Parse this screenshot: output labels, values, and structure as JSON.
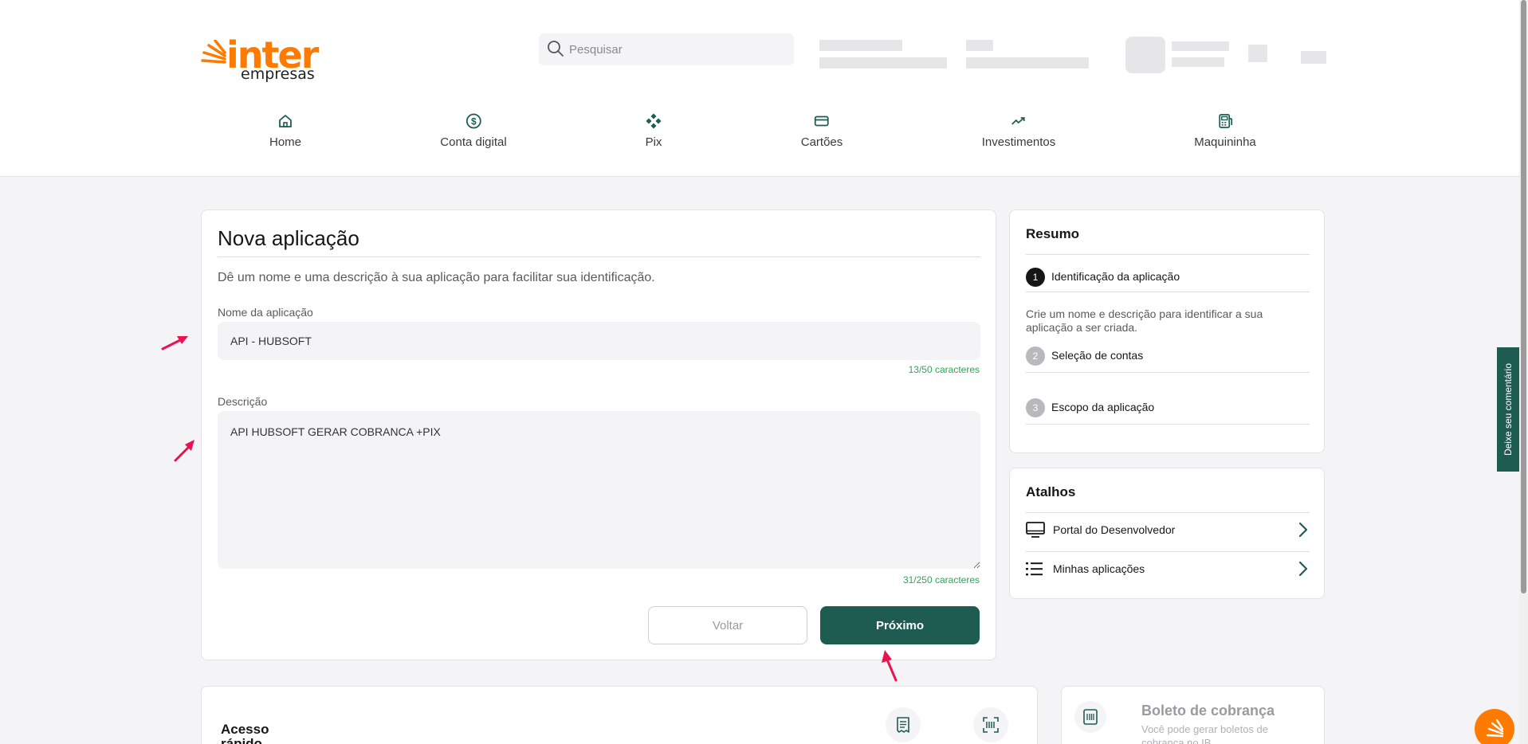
{
  "header": {
    "logo_brand": "inter",
    "logo_sub": "empresas",
    "search_placeholder": "Pesquisar"
  },
  "nav": [
    {
      "label": "Home",
      "icon": "home-icon"
    },
    {
      "label": "Conta digital",
      "icon": "dollar-circle-icon"
    },
    {
      "label": "Pix",
      "icon": "pix-icon"
    },
    {
      "label": "Cartões",
      "icon": "card-icon"
    },
    {
      "label": "Investimentos",
      "icon": "trend-up-icon"
    },
    {
      "label": "Maquininha",
      "icon": "pos-terminal-icon"
    }
  ],
  "form": {
    "title": "Nova aplicação",
    "intro": "Dê um nome e uma descrição à sua aplicação para facilitar sua identificação.",
    "name_label": "Nome da aplicação",
    "name_value": "API - HUBSOFT",
    "name_counter": "13/50 caracteres",
    "desc_label": "Descrição",
    "desc_value": "API HUBSOFT GERAR COBRANCA +PIX",
    "desc_counter": "31/250 caracteres",
    "back_label": "Voltar",
    "next_label": "Próximo"
  },
  "summary": {
    "title": "Resumo",
    "steps": [
      {
        "num": "1",
        "label": "Identificação da aplicação",
        "active": true
      },
      {
        "num": "2",
        "label": "Seleção de contas",
        "active": false
      },
      {
        "num": "3",
        "label": "Escopo da aplicação",
        "active": false
      }
    ],
    "step1_desc": "Crie um nome e descrição para identificar a sua aplicação a ser criada."
  },
  "shortcuts": {
    "title": "Atalhos",
    "items": [
      {
        "label": "Portal do Desenvolvedor",
        "icon": "monitor-icon"
      },
      {
        "label": "Minhas aplicações",
        "icon": "list-icon"
      }
    ]
  },
  "quick_access": {
    "title": "Acesso rápido"
  },
  "boleto": {
    "title": "Boleto de cobrança",
    "desc": "Você pode gerar boletos de cobrança no IB"
  },
  "feedback": {
    "label": "Deixe seu comentário"
  },
  "colors": {
    "brand_orange": "#ff7a00",
    "primary_green": "#1e5c52",
    "counter_green": "#2fa55b",
    "annotation_arrow": "#e8134f"
  }
}
